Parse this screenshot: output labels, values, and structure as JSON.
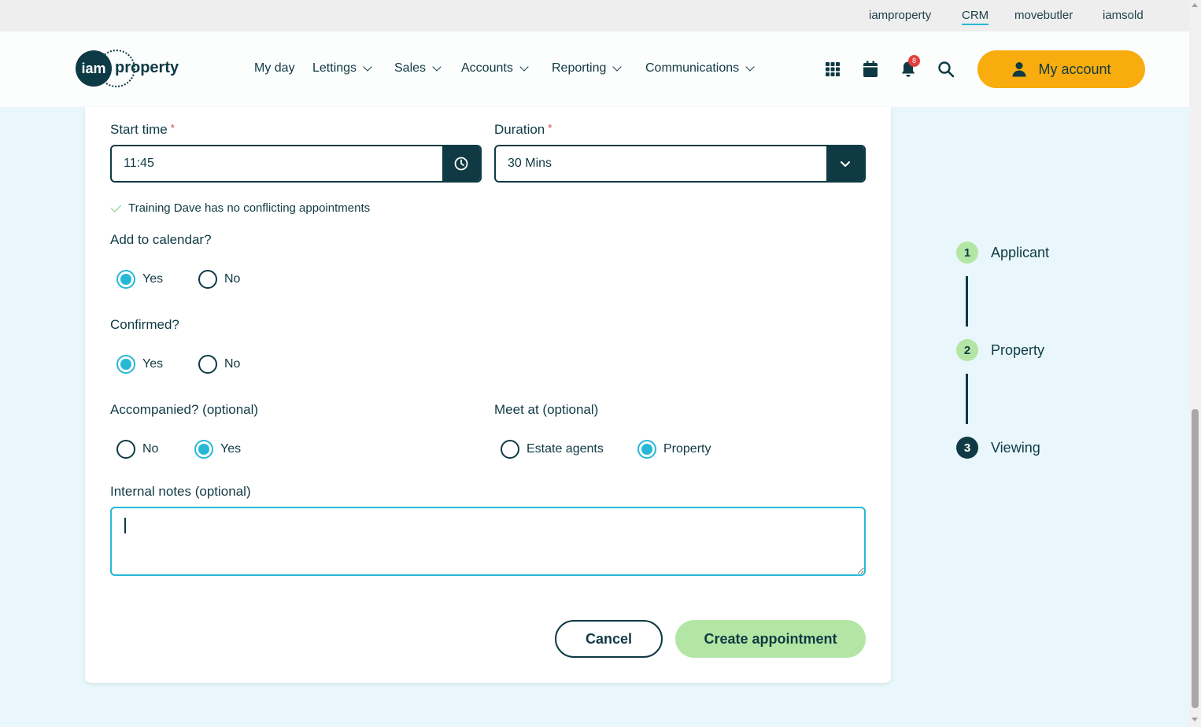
{
  "topbar": {
    "links": [
      "iamproperty",
      "CRM",
      "movebutler",
      "iamsold"
    ],
    "active": "CRM"
  },
  "header": {
    "logo": {
      "mark": "iam",
      "word": "property"
    },
    "nav": [
      "My day",
      "Lettings",
      "Sales",
      "Accounts",
      "Reporting",
      "Communications"
    ],
    "icons": [
      "apps-grid-icon",
      "calendar-icon",
      "bell-icon",
      "search-icon"
    ],
    "notification_count": "8",
    "account_label": "My account"
  },
  "form": {
    "start_time": {
      "label": "Start time",
      "required_mark": "*",
      "value": "11:45"
    },
    "duration": {
      "label": "Duration",
      "required_mark": "*",
      "value": "30 Mins"
    },
    "conflict_message": "Training Dave has no conflicting appointments",
    "add_to_calendar": {
      "label": "Add to calendar?",
      "options": [
        "Yes",
        "No"
      ],
      "selected": "Yes"
    },
    "confirmed": {
      "label": "Confirmed?",
      "options": [
        "Yes",
        "No"
      ],
      "selected": "Yes"
    },
    "accompanied": {
      "label": "Accompanied? (optional)",
      "options": [
        "No",
        "Yes"
      ],
      "selected": "Yes"
    },
    "meet_at": {
      "label": "Meet at (optional)",
      "options": [
        "Estate agents",
        "Property"
      ],
      "selected": "Property"
    },
    "internal_notes": {
      "label": "Internal notes (optional)",
      "value": ""
    },
    "cancel_label": "Cancel",
    "create_label": "Create appointment"
  },
  "stepper": {
    "steps": [
      {
        "number": "1",
        "label": "Applicant"
      },
      {
        "number": "2",
        "label": "Property"
      },
      {
        "number": "3",
        "label": "Viewing"
      }
    ],
    "current": "3"
  },
  "colors": {
    "navy": "#0f3a44",
    "accent": "#26b8d6",
    "account_orange": "#f8ac0d",
    "success_green": "#b3e6a4",
    "background": "#e9f7fc"
  }
}
